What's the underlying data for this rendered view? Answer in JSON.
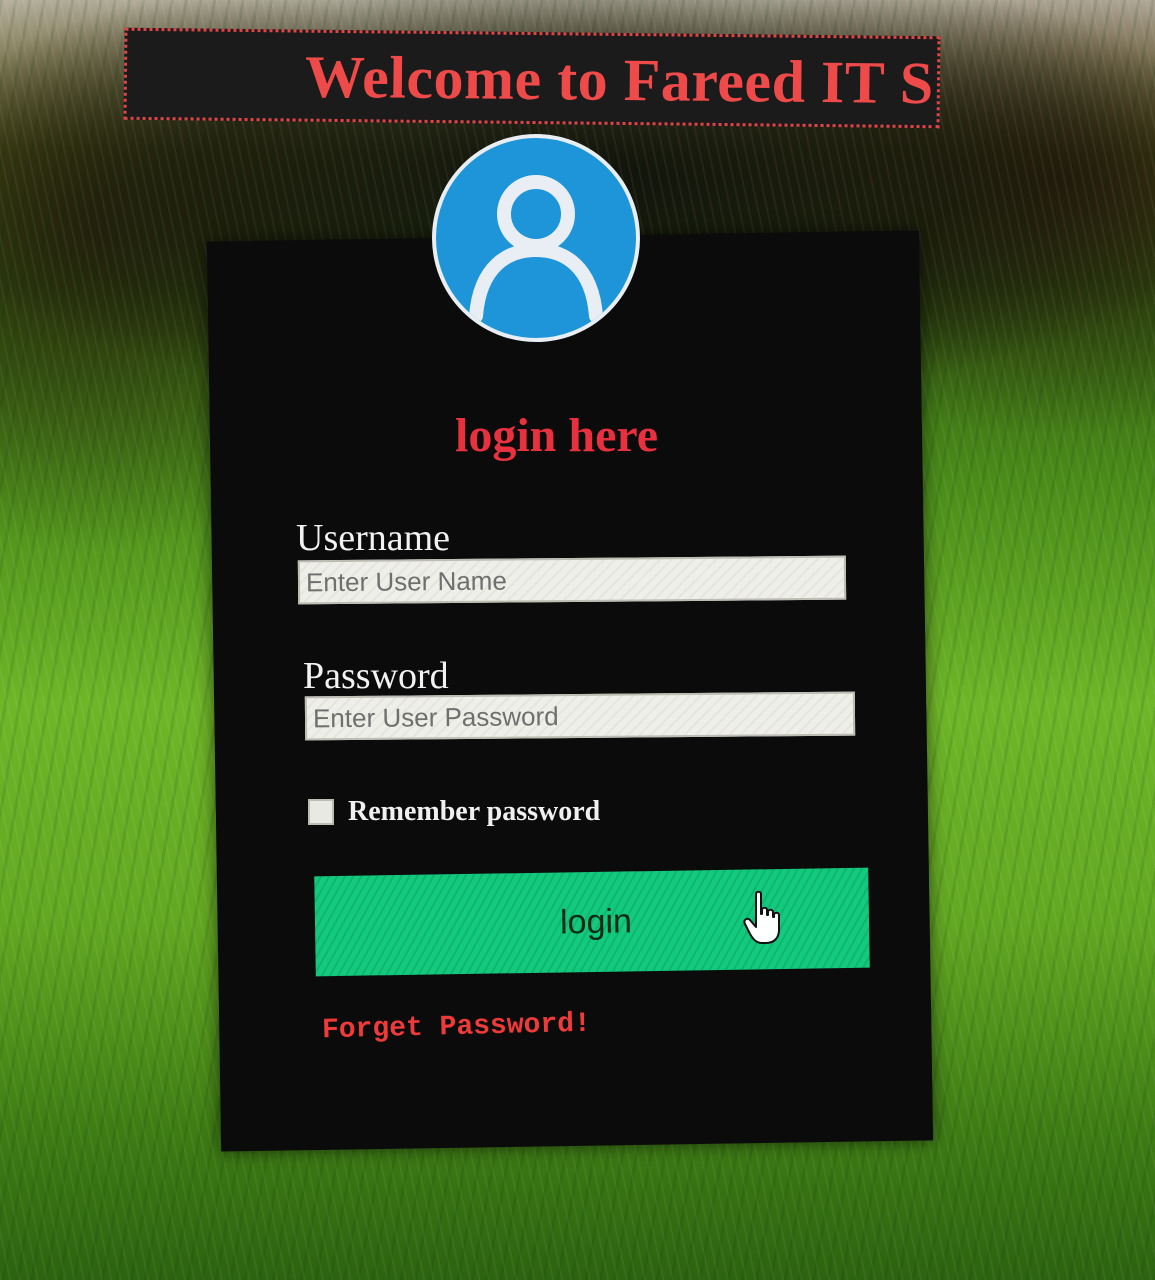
{
  "banner": {
    "text": "Welcome to Fareed IT S"
  },
  "login_form": {
    "avatar_icon": "user-profile-icon",
    "heading": "login here",
    "username_label": "Username",
    "username_placeholder": "Enter User Name",
    "password_label": "Password",
    "password_placeholder": "Enter User Password",
    "remember_label": "Remember password",
    "remember_checked": false,
    "login_button_label": "login",
    "forget_link": "Forget Password!",
    "cursor_icon": "hand-pointer-icon"
  },
  "colors": {
    "banner_text": "#ef4a4a",
    "heading": "#e8313f",
    "button": "#13c97e",
    "avatar": "#1e95d8",
    "panel": "#0b0b0b"
  }
}
